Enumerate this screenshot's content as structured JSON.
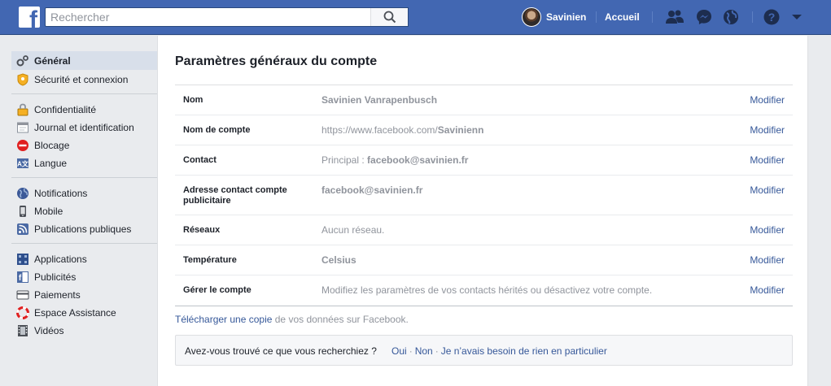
{
  "topbar": {
    "search_placeholder": "Rechercher",
    "user_name": "Savinien",
    "home_label": "Accueil",
    "logo_letter": "f"
  },
  "leftnav": {
    "groups": [
      {
        "items": [
          {
            "label": "Général",
            "icon": "gears-icon",
            "active": true
          },
          {
            "label": "Sécurité et connexion",
            "icon": "shield-icon",
            "active": false
          }
        ]
      },
      {
        "items": [
          {
            "label": "Confidentialité",
            "icon": "lock-icon"
          },
          {
            "label": "Journal et identification",
            "icon": "timeline-icon"
          },
          {
            "label": "Blocage",
            "icon": "block-icon"
          },
          {
            "label": "Langue",
            "icon": "language-icon"
          }
        ]
      },
      {
        "items": [
          {
            "label": "Notifications",
            "icon": "globe-icon"
          },
          {
            "label": "Mobile",
            "icon": "mobile-icon"
          },
          {
            "label": "Publications publiques",
            "icon": "rss-icon"
          }
        ]
      },
      {
        "items": [
          {
            "label": "Applications",
            "icon": "apps-icon"
          },
          {
            "label": "Publicités",
            "icon": "ads-icon"
          },
          {
            "label": "Paiements",
            "icon": "card-icon"
          },
          {
            "label": "Espace Assistance",
            "icon": "lifebuoy-icon"
          },
          {
            "label": "Vidéos",
            "icon": "film-icon"
          }
        ]
      }
    ]
  },
  "main": {
    "title": "Paramètres généraux du compte",
    "rows": [
      {
        "label": "Nom",
        "value_bold": "Savinien Vanrapenbusch",
        "edit": "Modifier"
      },
      {
        "label": "Nom de compte",
        "value_prefix": "https://www.facebook.com/",
        "value_bold": "Savinienn",
        "edit": "Modifier"
      },
      {
        "label": "Contact",
        "value_prefix": "Principal : ",
        "value_bold": "facebook@savinien.fr",
        "edit": "Modifier"
      },
      {
        "label": "Adresse contact compte publicitaire",
        "value_bold": "facebook@savinien.fr",
        "edit": "Modifier"
      },
      {
        "label": "Réseaux",
        "value_prefix": "Aucun réseau.",
        "edit": "Modifier"
      },
      {
        "label": "Température",
        "value_bold": "Celsius",
        "edit": "Modifier"
      },
      {
        "label": "Gérer le compte",
        "value_prefix": "Modifiez les paramètres de vos contacts hérités ou désactivez votre compte.",
        "edit": "Modifier"
      }
    ],
    "download": {
      "link": "Télécharger une copie",
      "rest": " de vos données sur Facebook."
    },
    "feedback": {
      "question": "Avez-vous trouvé ce que vous recherchiez ?",
      "yes": "Oui",
      "no": "Non",
      "nothing": "Je n’avais besoin de rien en particulier",
      "separator": "·"
    }
  },
  "colors": {
    "brand_blue": "#4267b2",
    "link_blue": "#365899",
    "page_bg": "#e9ebee"
  }
}
